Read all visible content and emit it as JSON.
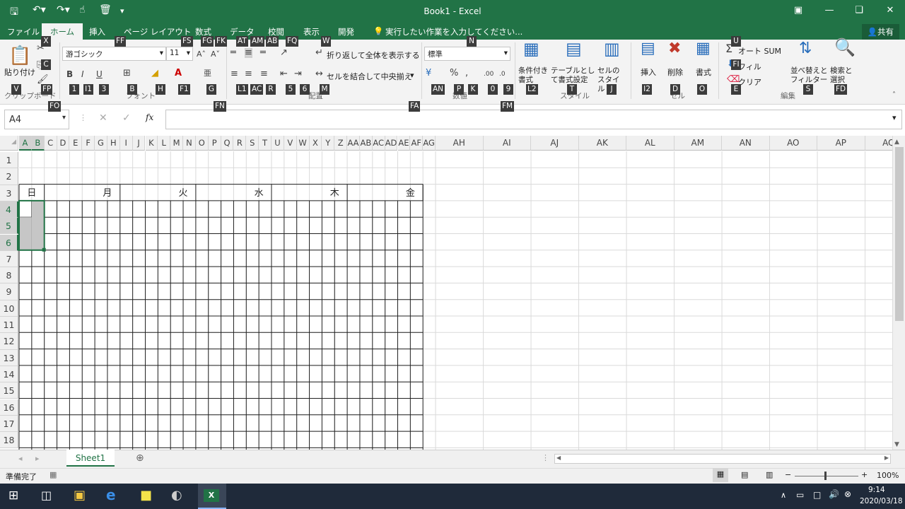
{
  "app": {
    "title": "Book1 - Excel",
    "accent": "#217346"
  },
  "quick_access": [
    "save-icon",
    "undo-icon",
    "redo-icon",
    "touch-mode-icon",
    "clear-format-icon",
    "customize-icon"
  ],
  "tabs": [
    {
      "label": "ファイル"
    },
    {
      "label": "ホーム",
      "active": true
    },
    {
      "label": "挿入"
    },
    {
      "label": "ページ レイアウト"
    },
    {
      "label": "数式"
    },
    {
      "label": "データ"
    },
    {
      "label": "校閲"
    },
    {
      "label": "表示"
    },
    {
      "label": "開発"
    },
    {
      "label": "実行したい作業を入力してください..."
    }
  ],
  "share_label": "共有",
  "ribbon": {
    "paste_label": "貼り付け",
    "font_name": "游ゴシック",
    "font_size": "11",
    "wrap_text": "折り返して全体を表示する",
    "merge_center": "セルを結合して中央揃え",
    "number_format": "標準",
    "conditional_format": "条件付き書式",
    "format_table": "テーブルとして書式設定",
    "cell_styles": "セルのスタイル",
    "insert": "挿入",
    "delete": "削除",
    "format": "書式",
    "autosum": "オート SUM",
    "fill": "フィル",
    "clear": "クリア",
    "sort_filter": "並べ替えとフィルター",
    "find_select": "検索と選択",
    "groups": {
      "clipboard": "クリップボード",
      "font": "フォント",
      "alignment": "配置",
      "number": "数値",
      "styles": "スタイル",
      "cells": "セル",
      "editing": "編集"
    }
  },
  "keytips": {
    "x": "X",
    "c": "C",
    "v": "V",
    "fp": "FP",
    "fo": "FO",
    "ff": "FF",
    "fs": "FS",
    "fg": "FG",
    "fk": "FK",
    "at": "AT",
    "am": "AM",
    "ab": "AB",
    "fq": "FQ",
    "w": "W",
    "n": "N",
    "u": "U",
    "fi": "FI",
    "e": "E",
    "b1": "1",
    "i1": "I1",
    "k3": "3",
    "b": "B",
    "h": "H",
    "f1": "F1",
    "g": "G",
    "fn": "FN",
    "l1": "L1",
    "ac": "AC",
    "r": "R",
    "k5": "5",
    "k6": "6",
    "m": "M",
    "fa": "FA",
    "an": "AN",
    "p": "P",
    "k": "K",
    "k0": "0",
    "k9": "9",
    "fm": "FM",
    "l2": "L2",
    "t": "T",
    "j": "J",
    "i2": "I2",
    "d": "D",
    "o": "O",
    "s": "S",
    "fd": "FD"
  },
  "formula_bar": {
    "name_box": "A4",
    "fx": "fx",
    "value": ""
  },
  "columns_narrow": [
    "A",
    "B",
    "C",
    "D",
    "E",
    "F",
    "G",
    "H",
    "I",
    "J",
    "K",
    "L",
    "M",
    "N",
    "O",
    "P",
    "Q",
    "R",
    "S",
    "T",
    "U",
    "V",
    "W",
    "X",
    "Y",
    "Z",
    "AA",
    "AB",
    "AC",
    "AD",
    "AE",
    "AF",
    "AG"
  ],
  "columns_wide": [
    "AH",
    "AI",
    "AJ",
    "AK",
    "AL",
    "AM",
    "AN",
    "AO",
    "AP",
    "AQ"
  ],
  "rows": [
    "1",
    "2",
    "3",
    "4",
    "5",
    "6",
    "7",
    "8",
    "9",
    "10",
    "11",
    "12",
    "13",
    "14",
    "15",
    "16",
    "17",
    "18"
  ],
  "day_headers": [
    {
      "text": "日"
    },
    {
      "text": "月"
    },
    {
      "text": "火"
    },
    {
      "text": "水"
    },
    {
      "text": "木"
    },
    {
      "text": "金"
    }
  ],
  "sheet_tabs": [
    {
      "label": "Sheet1",
      "active": true
    }
  ],
  "status": {
    "ready": "準備完了",
    "zoom": "100%"
  },
  "taskbar": {
    "time": "9:14",
    "date": "2020/03/18"
  }
}
